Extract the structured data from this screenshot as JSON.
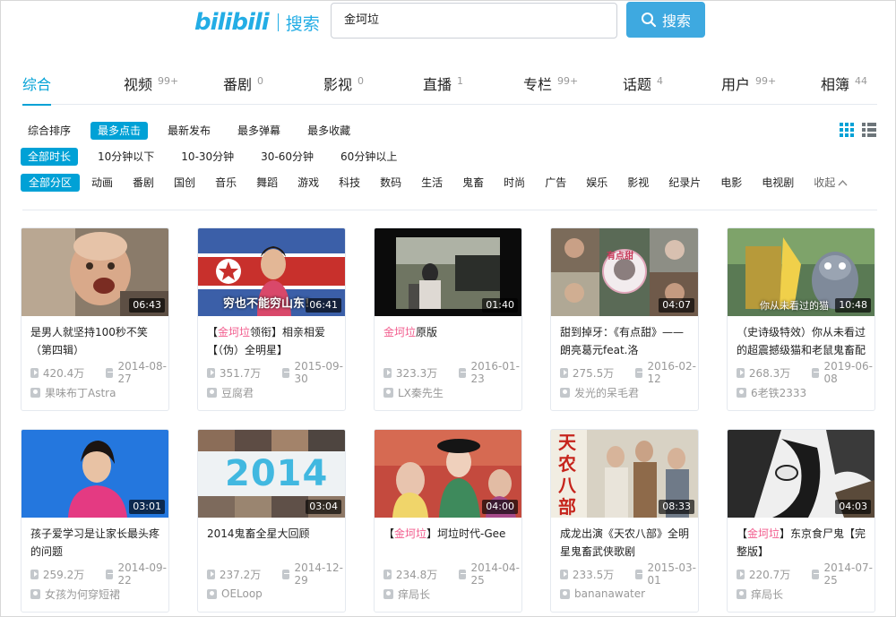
{
  "header": {
    "brand": "bilibili",
    "sub": "搜索",
    "search_value": "金坷垃",
    "search_button": "搜索"
  },
  "tabs": [
    {
      "label": "综合",
      "count": "",
      "active": true
    },
    {
      "label": "视频",
      "count": "99+"
    },
    {
      "label": "番剧",
      "count": "0"
    },
    {
      "label": "影视",
      "count": "0"
    },
    {
      "label": "直播",
      "count": "1"
    },
    {
      "label": "专栏",
      "count": "99+"
    },
    {
      "label": "话题",
      "count": "4"
    },
    {
      "label": "用户",
      "count": "99+"
    },
    {
      "label": "相簿",
      "count": "44"
    }
  ],
  "sort_options": [
    "综合排序",
    "最多点击",
    "最新发布",
    "最多弹幕",
    "最多收藏"
  ],
  "duration_options": [
    "全部时长",
    "10分钟以下",
    "10-30分钟",
    "30-60分钟",
    "60分钟以上"
  ],
  "zone_options": [
    "全部分区",
    "动画",
    "番剧",
    "国创",
    "音乐",
    "舞蹈",
    "游戏",
    "科技",
    "数码",
    "生活",
    "鬼畜",
    "时尚",
    "广告",
    "娱乐",
    "影视",
    "纪录片",
    "电影",
    "电视剧"
  ],
  "collapse_label": "收起",
  "colors": {
    "accent": "#00a1d6",
    "keyword": "#f25d8e",
    "meta": "#999999"
  },
  "videos": [
    {
      "title_pre": "",
      "keyword": "",
      "title_post": "是男人就坚持100秒不笑（第四辑）",
      "duration": "06:43",
      "views": "420.4万",
      "date": "2014-08-27",
      "uploader": "果味布丁Astra",
      "thumb_text": ""
    },
    {
      "title_pre": "【",
      "keyword": "金坷垃",
      "title_post": "领衔】相亲相爱【（伪）全明星】",
      "duration": "06:41",
      "views": "351.7万",
      "date": "2015-09-30",
      "uploader": "豆腐君",
      "thumb_text": "穷也不能穷山东!"
    },
    {
      "title_pre": "",
      "keyword": "金坷垃",
      "title_post": "原版",
      "duration": "01:40",
      "views": "323.3万",
      "date": "2016-01-23",
      "uploader": "LX秦先生",
      "thumb_text": ""
    },
    {
      "title_pre": "",
      "keyword": "",
      "title_post": "甜到掉牙：《有点甜》——朗亮葛元feat.洛",
      "duration": "04:07",
      "views": "275.5万",
      "date": "2016-02-12",
      "uploader": "发光的呆毛君",
      "thumb_text": "有点甜"
    },
    {
      "title_pre": "",
      "keyword": "",
      "title_post": "（史诗级特效）你从未看过的超震撼级猫和老鼠鬼畜配",
      "duration": "10:48",
      "views": "268.3万",
      "date": "2019-06-08",
      "uploader": "6老铁2333",
      "thumb_text": "你从未看过的猫"
    },
    {
      "title_pre": "",
      "keyword": "",
      "title_post": "孩子爱学习是让家长最头疼的问题",
      "duration": "03:01",
      "views": "259.2万",
      "date": "2014-09-22",
      "uploader": "女孩为何穿短裙",
      "thumb_text": ""
    },
    {
      "title_pre": "",
      "keyword": "",
      "title_post": "2014鬼畜全星大回顾",
      "duration": "03:04",
      "views": "237.2万",
      "date": "2014-12-29",
      "uploader": "OELoop",
      "thumb_text": "2014"
    },
    {
      "title_pre": "【",
      "keyword": "金坷垃",
      "title_post": "】坷垃时代-Gee",
      "duration": "04:00",
      "views": "234.8万",
      "date": "2014-04-25",
      "uploader": "痒局长",
      "thumb_text": ""
    },
    {
      "title_pre": "",
      "keyword": "",
      "title_post": "成龙出演《天农八部》全明星鬼畜武侠歌剧",
      "duration": "08:33",
      "views": "233.5万",
      "date": "2015-03-01",
      "uploader": "bananawater",
      "thumb_text": "天农八部"
    },
    {
      "title_pre": "【",
      "keyword": "金坷垃",
      "title_post": "】东京食尸鬼【完整版】",
      "duration": "04:03",
      "views": "220.7万",
      "date": "2014-07-25",
      "uploader": "痒局长",
      "thumb_text": ""
    }
  ]
}
